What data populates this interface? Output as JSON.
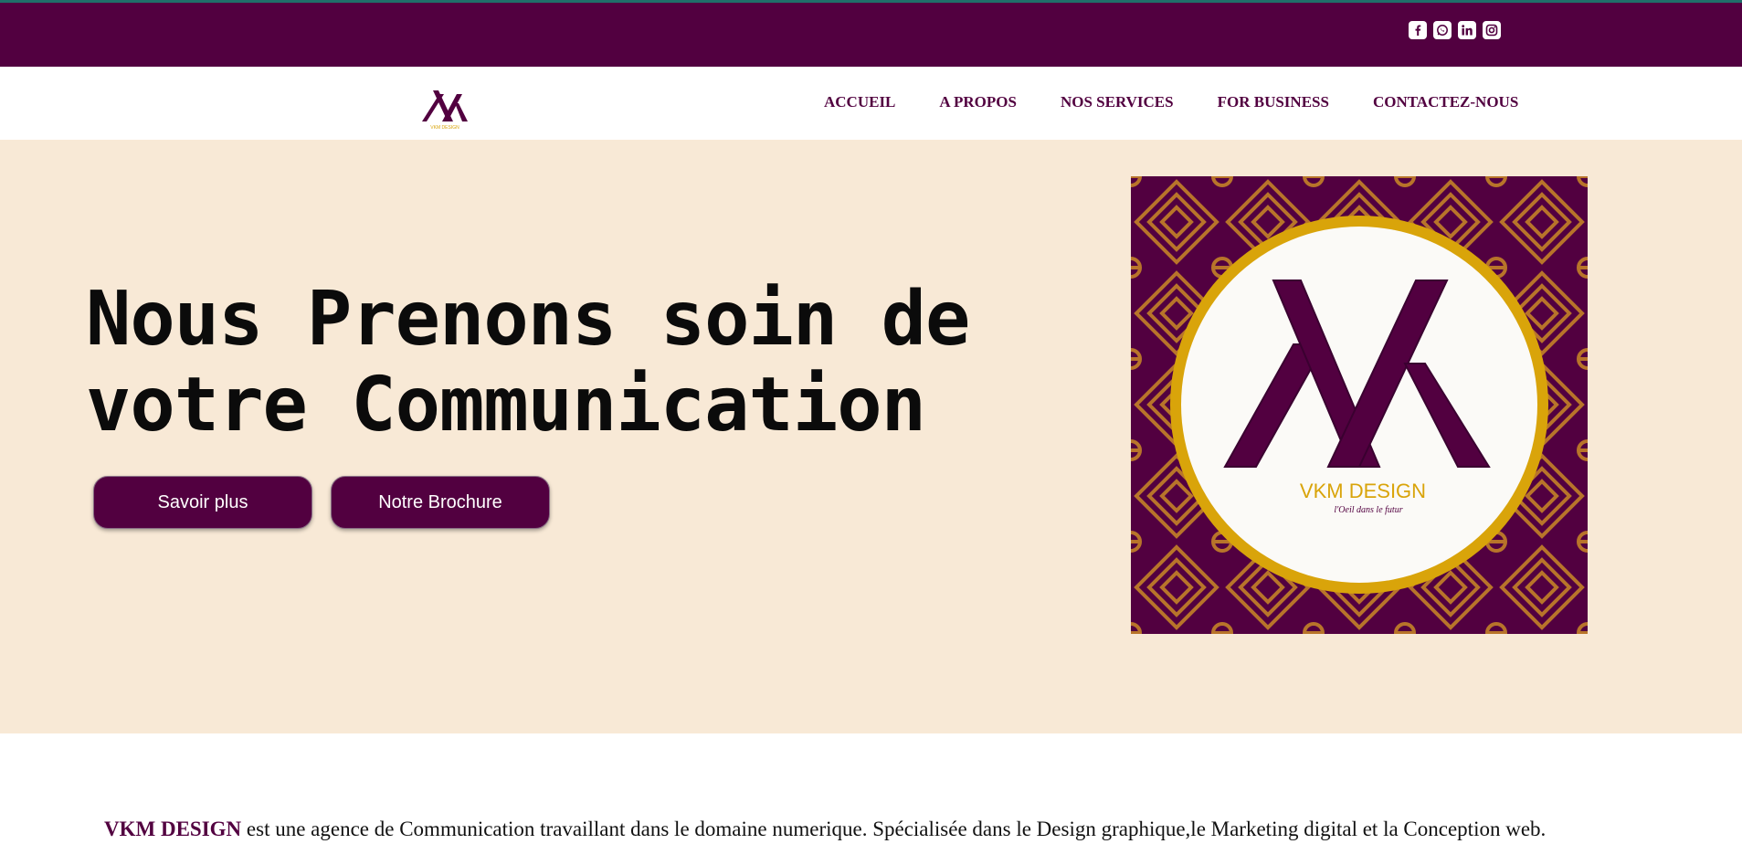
{
  "colors": {
    "brand": "#520040",
    "hero_bg": "#f8e9d6",
    "gold": "#d9a40a",
    "pattern": "#b8742a"
  },
  "topbar": {
    "socials": [
      {
        "icon": "facebook-icon",
        "glyph": "f"
      },
      {
        "icon": "whatsapp-icon",
        "glyph": "✆"
      },
      {
        "icon": "linkedin-icon",
        "glyph": "in"
      },
      {
        "icon": "instagram-icon",
        "glyph": "◎"
      }
    ]
  },
  "nav": {
    "logo_caption": "VKM DESIGN",
    "items": [
      "ACCUEIL",
      "A PROPOS",
      "NOS SERVICES",
      "FOR BUSINESS",
      "CONTACTEZ-NOUS"
    ]
  },
  "hero": {
    "headline_line1": "Nous Prenons soin de",
    "headline_line2": "votre Communication",
    "btn_primary": "Savoir plus",
    "btn_secondary": "Notre Brochure",
    "image": {
      "brand": "VKM DESIGN",
      "tagline": "l'Oeil dans le futur"
    }
  },
  "intro": {
    "brand": "VKM DESIGN",
    "text": " est une agence de Communication travaillant dans le domaine numerique. Spécialisée dans le Design graphique,le Marketing digital et la Conception web."
  }
}
